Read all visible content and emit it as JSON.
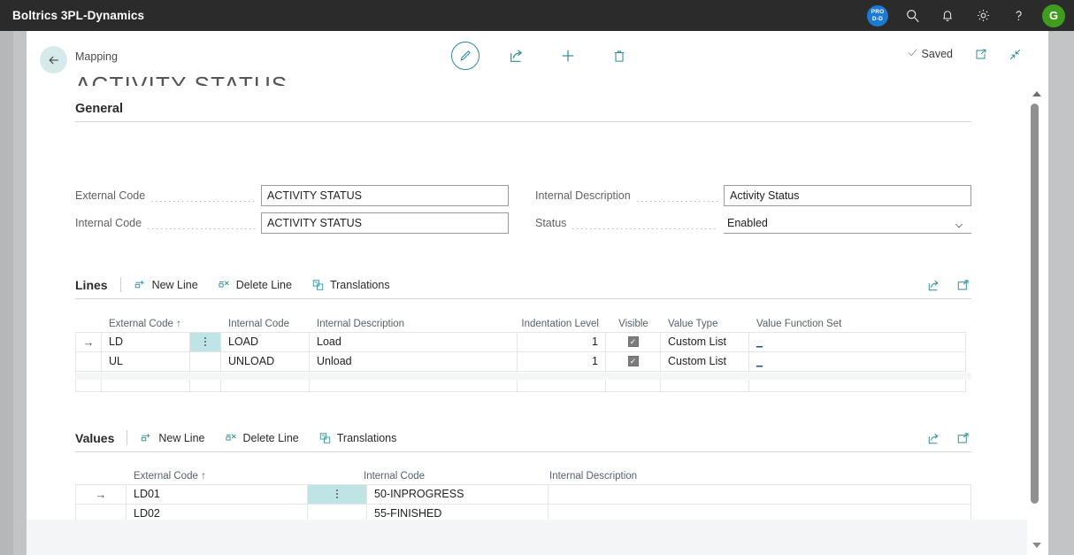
{
  "topbar": {
    "brand": "Boltrics 3PL-Dynamics",
    "env_badge": {
      "line1": "PRO",
      "line2": "D-D"
    },
    "icons": [
      "search-icon",
      "bell-icon",
      "gear-icon",
      "help-icon"
    ],
    "avatar_initial": "G"
  },
  "command_bar": {
    "back_label": "←",
    "breadcrumb": "Mapping",
    "title": "ACTIVITY STATUS",
    "actions": [
      "edit-icon",
      "share-icon",
      "new-icon",
      "delete-icon"
    ],
    "saved_label": "Saved",
    "right_icons": [
      "open-in-new-window-icon",
      "collapse-icon"
    ]
  },
  "general": {
    "heading": "General",
    "fields": [
      {
        "label": "External Code",
        "value": "ACTIVITY STATUS",
        "type": "text"
      },
      {
        "label": "Internal Code",
        "value": "ACTIVITY STATUS",
        "type": "text"
      },
      {
        "label": "Internal Description",
        "value": "Activity Status",
        "type": "text"
      },
      {
        "label": "Status",
        "value": "Enabled",
        "type": "dropdown"
      }
    ]
  },
  "lines": {
    "title": "Lines",
    "actions": [
      {
        "label": "New Line",
        "icon": "new-line-icon"
      },
      {
        "label": "Delete Line",
        "icon": "delete-line-icon"
      },
      {
        "label": "Translations",
        "icon": "translations-icon"
      }
    ],
    "right_icons": [
      "share-icon",
      "open-in-excel-icon"
    ],
    "columns": [
      "External Code ↑",
      "Internal Code",
      "Internal Description",
      "Indentation Level",
      "Visible",
      "Value Type",
      "Value Function Set"
    ],
    "rows": [
      {
        "selected": true,
        "external_code": "LD",
        "internal_code": "LOAD",
        "internal_description": "Load",
        "indentation_level": "1",
        "visible": true,
        "value_type": "Custom List",
        "value_function_set": "_"
      },
      {
        "selected": false,
        "external_code": "UL",
        "internal_code": "UNLOAD",
        "internal_description": "Unload",
        "indentation_level": "1",
        "visible": true,
        "value_type": "Custom List",
        "value_function_set": "_"
      },
      {
        "selected": false,
        "external_code": "",
        "internal_code": "",
        "internal_description": "",
        "indentation_level": "",
        "visible": false,
        "value_type": "",
        "value_function_set": ""
      }
    ]
  },
  "values": {
    "title": "Values",
    "actions": [
      {
        "label": "New Line",
        "icon": "new-line-icon"
      },
      {
        "label": "Delete Line",
        "icon": "delete-line-icon"
      },
      {
        "label": "Translations",
        "icon": "translations-icon"
      }
    ],
    "right_icons": [
      "share-icon",
      "open-in-excel-icon"
    ],
    "columns": [
      "External Code ↑",
      "Internal Code",
      "Internal Description"
    ],
    "rows": [
      {
        "selected": true,
        "external_code": "LD01",
        "internal_code": "50-INPROGRESS",
        "internal_description": ""
      },
      {
        "selected": false,
        "external_code": "LD02",
        "internal_code": "55-FINISHED",
        "internal_description": ""
      },
      {
        "selected": false,
        "external_code": "",
        "internal_code": "",
        "internal_description": ""
      }
    ]
  },
  "colors": {
    "topbar": "#2b2b2b",
    "accent_teal": "#2e8b93",
    "row_highlight": "#bfe4e6",
    "back_circle": "#d6eaec",
    "avatar_green": "#3f9c1f",
    "badge_blue": "#1b7ad1"
  }
}
